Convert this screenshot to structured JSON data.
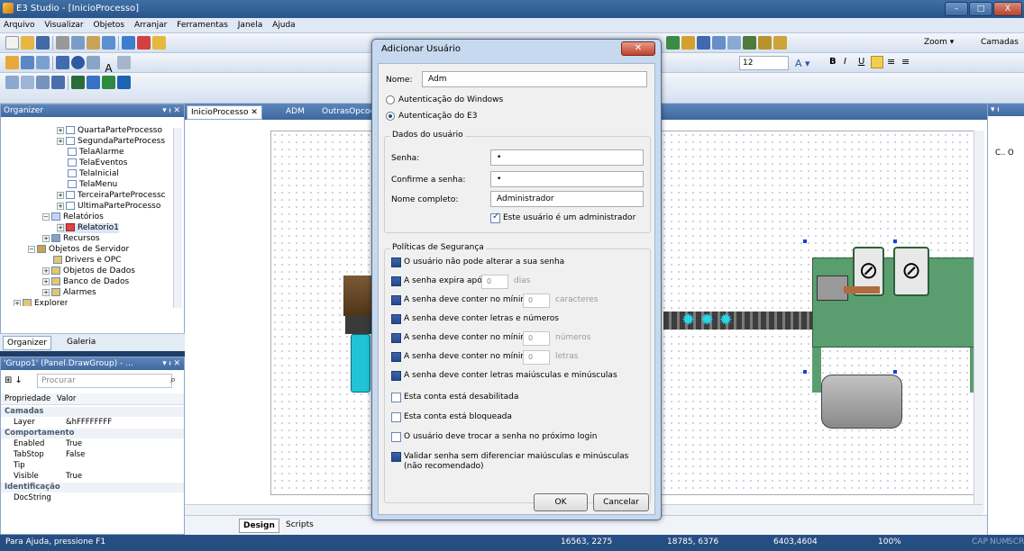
{
  "app": {
    "title": "E3 Studio - [InicioProcesso]"
  },
  "window": {
    "min": "–",
    "max": "□",
    "close": "X"
  },
  "menu": [
    "Arquivo",
    "Visualizar",
    "Objetos",
    "Arranjar",
    "Ferramentas",
    "Janela",
    "Ajuda"
  ],
  "toolbar": {
    "zoom_label": "Zoom ▾",
    "camadas_label": "Camadas",
    "font_size": "12"
  },
  "organizer": {
    "title": "Organizer",
    "tree": [
      "QuartaParteProcesso",
      "SegundaParteProcess",
      "TelaAlarme",
      "TelaEventos",
      "TelaInicial",
      "TelaMenu",
      "TerceiraParteProcessc",
      "UltimaParteProcesso",
      "Relatórios",
      "Relatorio1",
      "Recursos",
      "Objetos de Servidor",
      "Drivers e OPC",
      "Objetos de Dados",
      "Banco de Dados",
      "Alarmes",
      "Explorer"
    ],
    "tabs": [
      "Organizer",
      "Galeria"
    ]
  },
  "properties": {
    "title": "'Grupo1' (Panel.DrawGroup) - ...",
    "search_placeholder": "Procurar",
    "col_prop": "Propriedade",
    "col_val": "Valor",
    "rows": [
      {
        "name": "Camadas",
        "value": "",
        "cat": true
      },
      {
        "name": "Layer",
        "value": "&hFFFFFFFF"
      },
      {
        "name": "Comportamento",
        "value": "",
        "cat": true
      },
      {
        "name": "Enabled",
        "value": "True"
      },
      {
        "name": "TabStop",
        "value": "False"
      },
      {
        "name": "Tip",
        "value": ""
      },
      {
        "name": "Visible",
        "value": "True"
      },
      {
        "name": "Identificação",
        "value": "",
        "cat": true
      },
      {
        "name": "DocString",
        "value": ""
      }
    ]
  },
  "doc": {
    "tabs": [
      "InicioProcesso",
      "ADM",
      "OutrasOpcoes"
    ],
    "bottom_tabs": [
      "Design",
      "Scripts"
    ]
  },
  "right_pane": {
    "label": "C.. O"
  },
  "status": {
    "help": "Para Ajuda, pressione F1",
    "coord1": "16563, 2275",
    "coord2": "18785, 6376",
    "coord3": "6403,4604",
    "zoom": "100%",
    "caps": "CAP",
    "num": "NUM",
    "scr": "SCR"
  },
  "dialog": {
    "title": "Adicionar Usuário",
    "name_label": "Nome:",
    "name_value": "Adm",
    "auth_windows": "Autenticação do Windows",
    "auth_e3": "Autenticação do E3",
    "user_group": "Dados do usuário",
    "senha_label": "Senha:",
    "senha_value": "•",
    "confirm_label": "Confirme a senha:",
    "confirm_value": "•",
    "fullname_label": "Nome completo:",
    "fullname_value": "Administrador",
    "admin_check": "Este usuário é um administrador",
    "policy_group": "Políticas de Segurança",
    "policies": [
      {
        "text": "O usuário não pode alterar a sua senha"
      },
      {
        "text": "A senha expira após",
        "num": "0",
        "unit": "dias"
      },
      {
        "text": "A senha deve conter no mínimo",
        "num": "0",
        "unit": "caracteres"
      },
      {
        "text": "A senha deve conter letras e números"
      },
      {
        "text": "A senha deve conter no mínimo",
        "num": "0",
        "unit": "números"
      },
      {
        "text": "A senha deve conter no mínimo",
        "num": "0",
        "unit": "letras"
      },
      {
        "text": "A senha deve conter letras maiúsculas e minúsculas"
      },
      {
        "text": "Esta conta está desabilitada"
      },
      {
        "text": "Esta conta está bloqueada"
      },
      {
        "text": "O usuário deve trocar a senha no próximo login"
      },
      {
        "text": "Validar senha sem diferenciar maiúsculas e minúsculas (não recomendado)"
      }
    ],
    "ok": "OK",
    "cancel": "Cancelar"
  }
}
